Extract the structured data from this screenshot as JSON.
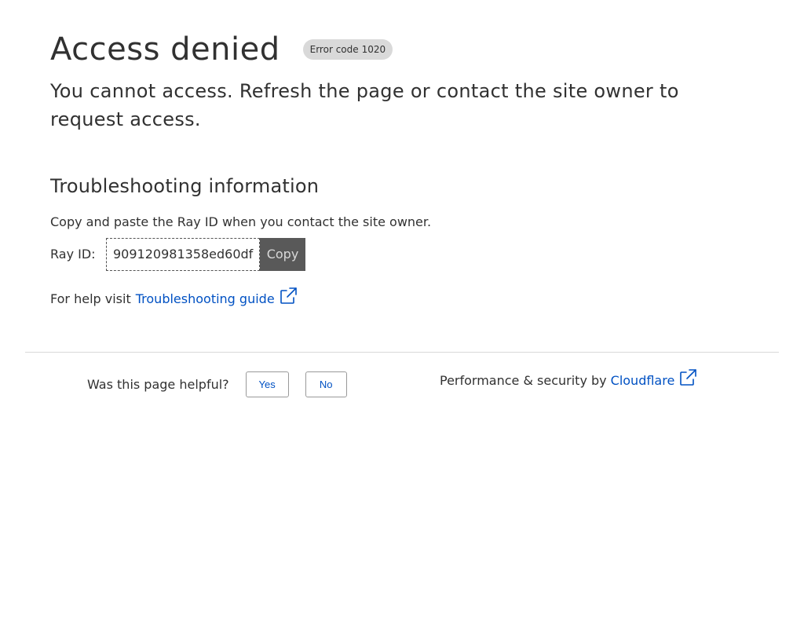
{
  "header": {
    "title": "Access denied",
    "error_label": "Error code",
    "error_code": "1020"
  },
  "message": "You cannot access. Refresh the page or contact the site owner to request access.",
  "troubleshooting": {
    "heading": "Troubleshooting information",
    "instructions": "Copy and paste the Ray ID when you contact the site owner.",
    "ray_label": "Ray ID:",
    "ray_id": "909120981358ed60df",
    "copy_label": "Copy",
    "help_prefix": "For help visit",
    "help_link": "Troubleshooting guide",
    "help_icon": "external-link-icon"
  },
  "footer": {
    "feedback_question": "Was this page helpful?",
    "yes_label": "Yes",
    "no_label": "No",
    "performance_prefix": "Performance & security by",
    "performance_link": "Cloudflare",
    "performance_icon": "external-link-icon"
  },
  "colors": {
    "text": "#313131",
    "link": "#0051c3",
    "badge_bg": "#d9d9d9",
    "copy_bg": "#595959",
    "divider": "#d9d9d9"
  }
}
